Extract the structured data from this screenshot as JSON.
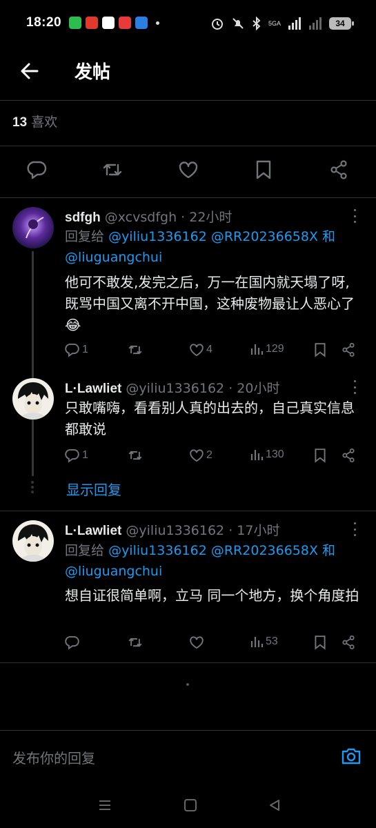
{
  "status": {
    "time": "18:20",
    "network": "5GA",
    "battery": "34",
    "app_icon_colors": [
      "#2dbd4e",
      "#e03a2f",
      "#ffffff",
      "#e73b3b",
      "#2a7fe0"
    ]
  },
  "header": {
    "title": "发帖",
    "back_icon": "arrow-left-icon"
  },
  "likes": {
    "count": "13",
    "label": "喜欢"
  },
  "actions": [
    "reply-icon",
    "retweet-icon",
    "like-icon",
    "bookmark-icon",
    "share-icon"
  ],
  "replies": [
    {
      "name": "sdfgh",
      "handle": "@xcvsdfgh",
      "time": "· 22小时",
      "reply_prefix": "回复给",
      "mentions": [
        "@yiliu1336162",
        "@RR20236658X",
        "和",
        "@liuguangchui"
      ],
      "text": "他可不敢发,发完之后，万一在国内就天塌了呀,既骂中国又离不开中国，这种废物最让人恶心了😂",
      "replies": "1",
      "retweets": "",
      "likes": "4",
      "views": "129"
    },
    {
      "name": "L·Lawliet",
      "handle": "@yiliu1336162",
      "time": "· 20小时",
      "text": "只敢嘴嗨，看看别人真的出去的，自己真实信息都敢说",
      "replies": "1",
      "retweets": "",
      "likes": "2",
      "views": "130"
    },
    {
      "name": "L·Lawliet",
      "handle": "@yiliu1336162",
      "time": "· 17小时",
      "reply_prefix": "回复给",
      "mentions": [
        "@yiliu1336162",
        "@RR20236658X",
        "和",
        "@liuguangchui"
      ],
      "text": "想自证很简单啊，立马 同一个地方，换个角度拍",
      "replies": "",
      "retweets": "",
      "likes": "",
      "views": "53"
    }
  ],
  "show_replies": "显示回复",
  "compose": {
    "placeholder": "发布你的回复",
    "camera_icon": "camera-icon"
  },
  "accent_color": "#1d9bf0"
}
